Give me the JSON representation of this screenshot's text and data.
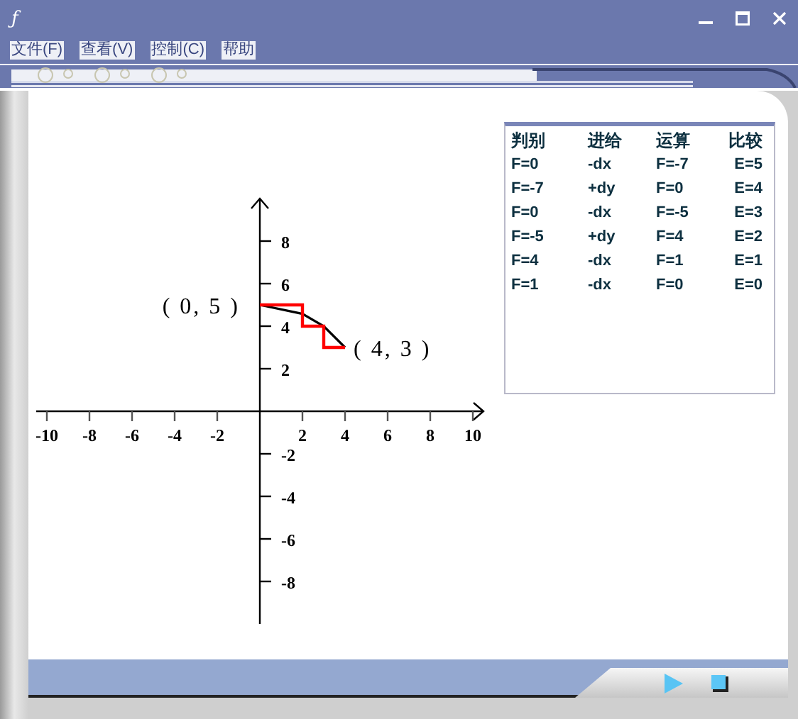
{
  "window": {
    "title_icon": "ƒ"
  },
  "menu": [
    {
      "label": "文件(F)"
    },
    {
      "label": "查看(V)"
    },
    {
      "label": "控制(C)"
    },
    {
      "label": "帮助"
    }
  ],
  "chart": {
    "chart_data": {
      "type": "line",
      "x": [
        0,
        2,
        2,
        3,
        3,
        4
      ],
      "series": [
        {
          "color": "#ff0000",
          "values": [
            5,
            5,
            4,
            4,
            3,
            3
          ]
        },
        {
          "color": "#000000",
          "values": [
            5,
            4.58,
            4.58,
            4,
            4,
            3
          ]
        }
      ],
      "xlim": [
        -10.5,
        10.5
      ],
      "ylim": [
        -10,
        10
      ],
      "xticks": [
        {
          "value": -10,
          "label": "-10"
        },
        -8,
        -6,
        -4,
        -2,
        2,
        4,
        6,
        8,
        10
      ],
      "yticks": [
        8,
        6,
        4,
        2,
        -2,
        -4,
        -6,
        -8
      ],
      "annotations": [
        "( 0, 5 )",
        "( 4, 3 )"
      ]
    }
  },
  "table": {
    "columns": [
      "判别",
      "进给",
      "运算",
      "比较"
    ],
    "rows": [
      [
        "F=0",
        "-dx",
        "F=-7",
        "E=5"
      ],
      [
        "F=-7",
        "+dy",
        "F=0",
        "E=4"
      ],
      [
        "F=0",
        "-dx",
        "F=-5",
        "E=3"
      ],
      [
        "F=-5",
        "+dy",
        "F=4",
        "E=2"
      ],
      [
        "F=4",
        "-dx",
        "F=1",
        "E=1"
      ],
      [
        "F=1",
        "-dx",
        "F=0",
        "E=0"
      ]
    ]
  },
  "controls": [
    {
      "kind": "play"
    },
    {
      "kind": "stop"
    }
  ]
}
